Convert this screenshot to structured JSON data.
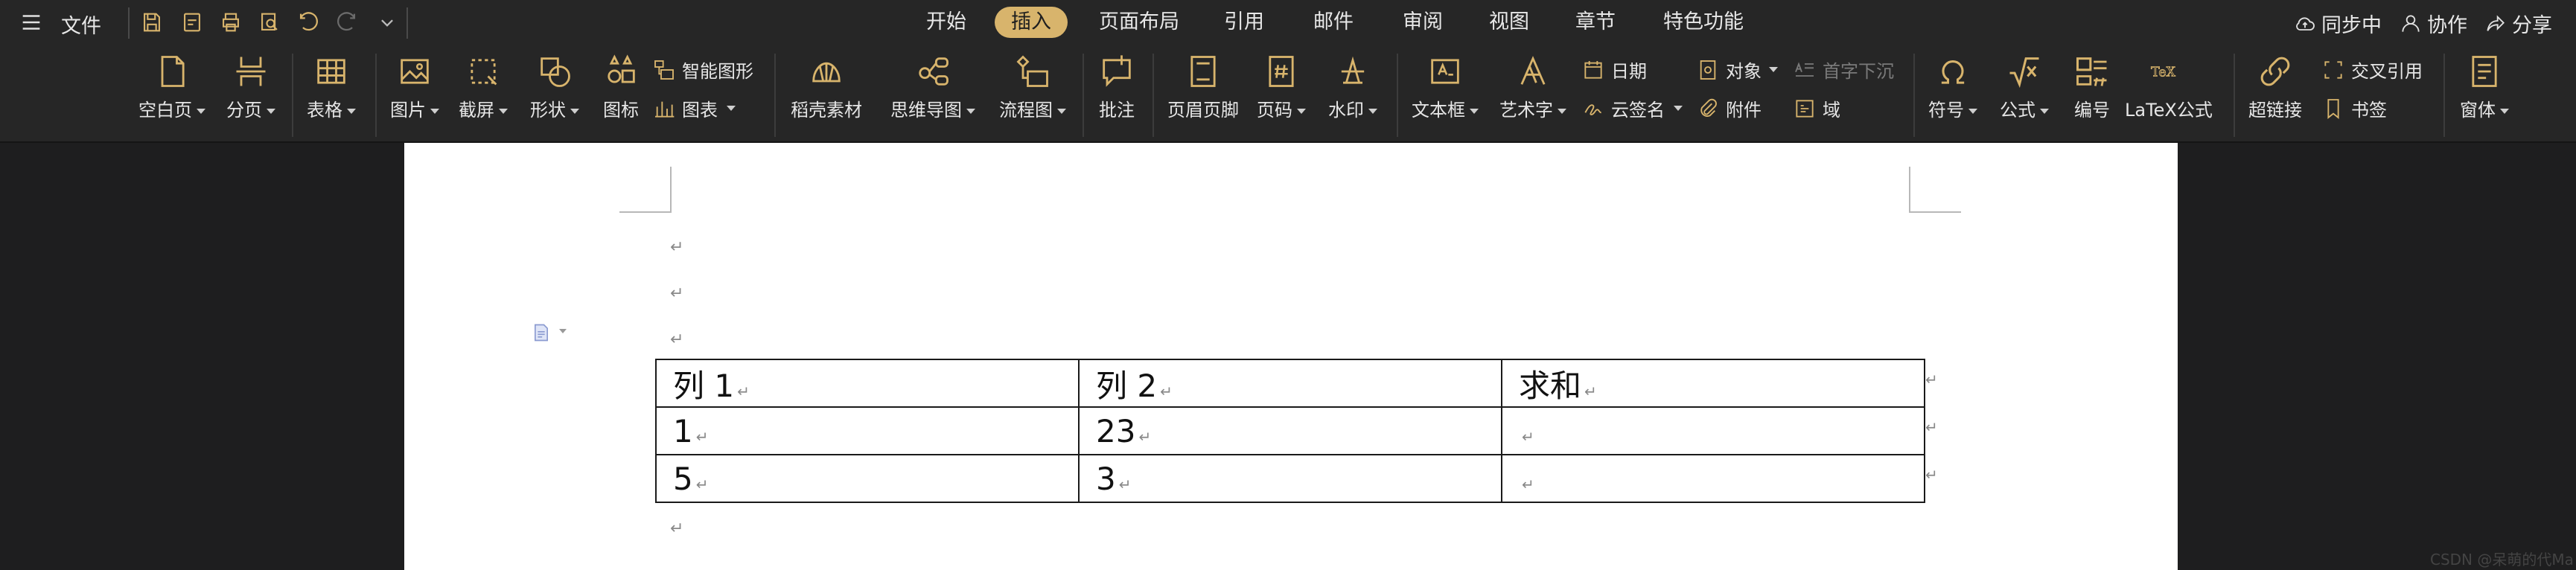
{
  "menu": {
    "file_label": "文件"
  },
  "tabs": [
    {
      "label": "开始"
    },
    {
      "label": "插入"
    },
    {
      "label": "页面布局"
    },
    {
      "label": "引用"
    },
    {
      "label": "邮件"
    },
    {
      "label": "审阅"
    },
    {
      "label": "视图"
    },
    {
      "label": "章节"
    },
    {
      "label": "特色功能"
    }
  ],
  "right": {
    "sync": "同步中",
    "collab": "协作",
    "share": "分享"
  },
  "ribbon": {
    "blank_page": "空白页",
    "page_break": "分页",
    "table": "表格",
    "picture": "图片",
    "screenshot": "截屏",
    "shape": "形状",
    "icon": "图标",
    "smart_shape": "智能图形",
    "chart": "图表",
    "daoke": "稻壳素材",
    "mindmap": "思维导图",
    "flowchart": "流程图",
    "comment": "批注",
    "header_footer": "页眉页脚",
    "page_number": "页码",
    "watermark": "水印",
    "textbox": "文本框",
    "wordart": "艺术字",
    "date": "日期",
    "cloud_sign": "云签名",
    "object": "对象",
    "attachment": "附件",
    "drop_cap": "首字下沉",
    "field": "域",
    "symbol": "符号",
    "formula": "公式",
    "numbering": "编号",
    "latex": "LaTeX公式",
    "hyperlink": "超链接",
    "cross_ref": "交叉引用",
    "bookmark": "书签",
    "window": "窗体"
  },
  "document": {
    "paragraph_mark": "↵",
    "table": {
      "headers": [
        "列 1",
        "列 2",
        "求和"
      ],
      "rows": [
        [
          "1",
          "23",
          ""
        ],
        [
          "5",
          "3",
          ""
        ]
      ]
    }
  },
  "watermark_text": "CSDN @呆萌的代Ma"
}
